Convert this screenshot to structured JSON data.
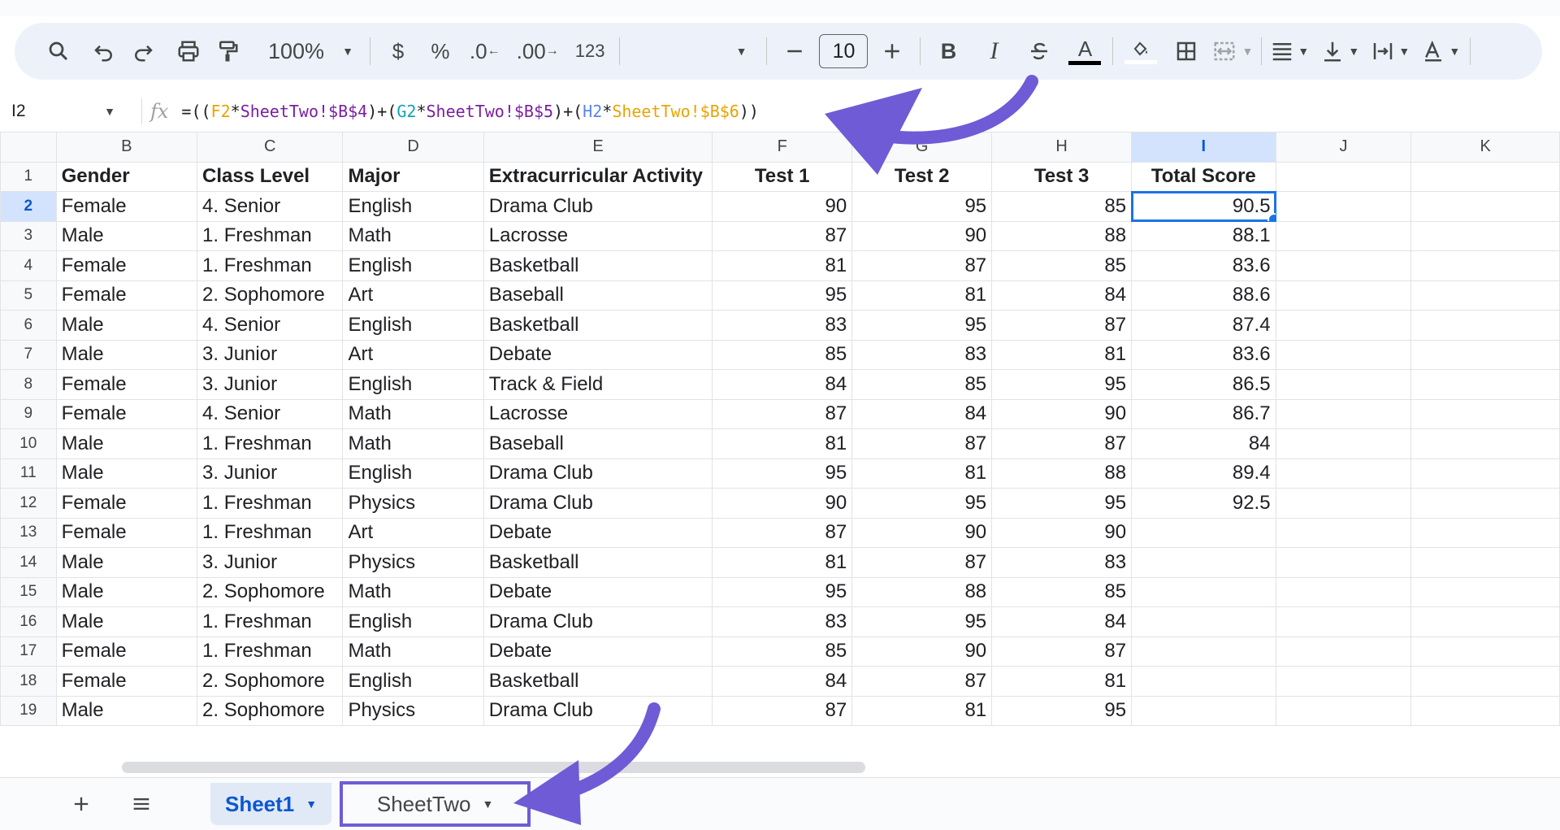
{
  "toolbar": {
    "zoom": "100%",
    "currency": "$",
    "percent": "%",
    "decrease_decimal": ".0",
    "increase_decimal": ".00",
    "number_format": "123",
    "font_size": "10",
    "bold": "B",
    "italic": "I",
    "text_color": "A"
  },
  "formula_bar": {
    "cell_ref": "I2",
    "fx": "fx",
    "parts": [
      "=((",
      "F2",
      "*",
      "SheetTwo!$B$4",
      ")+(",
      "G2",
      "*",
      "SheetTwo!$B$5",
      ")+(",
      "H2",
      "*",
      "SheetTwo!$B$6",
      "))"
    ]
  },
  "grid": {
    "columns": [
      "B",
      "C",
      "D",
      "E",
      "F",
      "G",
      "H",
      "I",
      "J",
      "K"
    ],
    "selected_column": "I",
    "selected_row": "2",
    "header_row": [
      "Gender",
      "Class Level",
      "Major",
      "Extracurricular Activity",
      "Test 1",
      "Test 2",
      "Test 3",
      "Total Score"
    ],
    "rows": [
      [
        "2",
        "Female",
        "4. Senior",
        "English",
        "Drama Club",
        "90",
        "95",
        "85",
        "90.5"
      ],
      [
        "3",
        "Male",
        "1. Freshman",
        "Math",
        "Lacrosse",
        "87",
        "90",
        "88",
        "88.1"
      ],
      [
        "4",
        "Female",
        "1. Freshman",
        "English",
        "Basketball",
        "81",
        "87",
        "85",
        "83.6"
      ],
      [
        "5",
        "Female",
        "2. Sophomore",
        "Art",
        "Baseball",
        "95",
        "81",
        "84",
        "88.6"
      ],
      [
        "6",
        "Male",
        "4. Senior",
        "English",
        "Basketball",
        "83",
        "95",
        "87",
        "87.4"
      ],
      [
        "7",
        "Male",
        "3. Junior",
        "Art",
        "Debate",
        "85",
        "83",
        "81",
        "83.6"
      ],
      [
        "8",
        "Female",
        "3. Junior",
        "English",
        "Track & Field",
        "84",
        "85",
        "95",
        "86.5"
      ],
      [
        "9",
        "Female",
        "4. Senior",
        "Math",
        "Lacrosse",
        "87",
        "84",
        "90",
        "86.7"
      ],
      [
        "10",
        "Male",
        "1. Freshman",
        "Math",
        "Baseball",
        "81",
        "87",
        "87",
        "84"
      ],
      [
        "11",
        "Male",
        "3. Junior",
        "English",
        "Drama Club",
        "95",
        "81",
        "88",
        "89.4"
      ],
      [
        "12",
        "Female",
        "1. Freshman",
        "Physics",
        "Drama Club",
        "90",
        "95",
        "95",
        "92.5"
      ],
      [
        "13",
        "Female",
        "1. Freshman",
        "Art",
        "Debate",
        "87",
        "90",
        "90",
        ""
      ],
      [
        "14",
        "Male",
        "3. Junior",
        "Physics",
        "Basketball",
        "81",
        "87",
        "83",
        ""
      ],
      [
        "15",
        "Male",
        "2. Sophomore",
        "Math",
        "Debate",
        "95",
        "88",
        "85",
        ""
      ],
      [
        "16",
        "Male",
        "1. Freshman",
        "English",
        "Drama Club",
        "83",
        "95",
        "84",
        ""
      ],
      [
        "17",
        "Female",
        "1. Freshman",
        "Math",
        "Debate",
        "85",
        "90",
        "87",
        ""
      ],
      [
        "18",
        "Female",
        "2. Sophomore",
        "English",
        "Basketball",
        "84",
        "87",
        "81",
        ""
      ],
      [
        "19",
        "Male",
        "2. Sophomore",
        "Physics",
        "Drama Club",
        "87",
        "81",
        "95",
        ""
      ]
    ]
  },
  "sheet_tabs": [
    {
      "label": "Sheet1",
      "active": true
    },
    {
      "label": "SheetTwo",
      "active": false
    }
  ],
  "colors": {
    "accent": "#1a73e8",
    "annotation": "#6f5bd6",
    "toolbar_bg": "#edf2fa"
  }
}
